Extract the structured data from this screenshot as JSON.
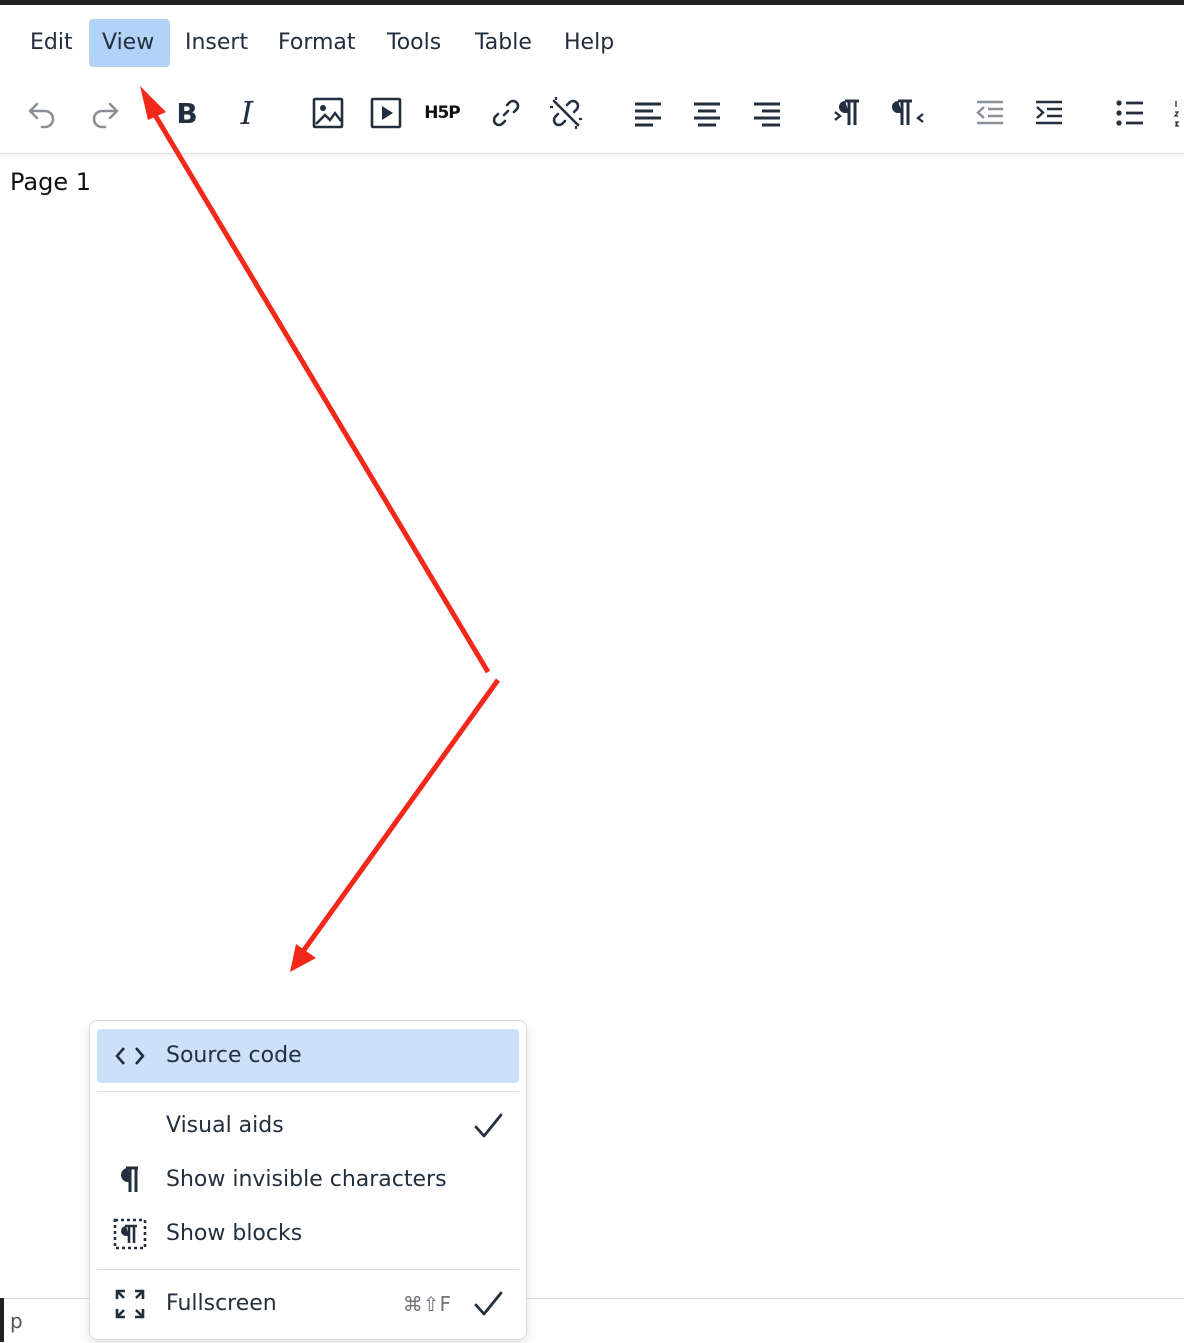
{
  "menubar": {
    "items": [
      "Edit",
      "View",
      "Insert",
      "Format",
      "Tools",
      "Table",
      "Help"
    ],
    "active": "View"
  },
  "toolbar": {
    "buttons": [
      {
        "name": "undo-button",
        "icon": "undo-icon"
      },
      {
        "name": "redo-button",
        "icon": "redo-icon"
      },
      {
        "name": "bold-button",
        "icon": "bold-icon",
        "glyph": "B"
      },
      {
        "name": "italic-button",
        "icon": "italic-icon",
        "glyph": "I"
      },
      {
        "name": "insert-image-button",
        "icon": "image-icon"
      },
      {
        "name": "insert-media-button",
        "icon": "play-icon"
      },
      {
        "name": "h5p-button",
        "icon": "h5p-icon",
        "glyph": "H5P"
      },
      {
        "name": "insert-link-button",
        "icon": "link-icon"
      },
      {
        "name": "remove-link-button",
        "icon": "unlink-icon"
      },
      {
        "name": "align-left-button",
        "icon": "align-left-icon"
      },
      {
        "name": "align-center-button",
        "icon": "align-center-icon"
      },
      {
        "name": "align-right-button",
        "icon": "align-right-icon"
      },
      {
        "name": "ltr-button",
        "icon": "ltr-icon"
      },
      {
        "name": "rtl-button",
        "icon": "rtl-icon"
      },
      {
        "name": "outdent-button",
        "icon": "outdent-icon"
      },
      {
        "name": "indent-button",
        "icon": "indent-icon"
      },
      {
        "name": "bullet-list-button",
        "icon": "bullet-list-icon"
      },
      {
        "name": "numbered-list-button",
        "icon": "numbered-list-icon"
      }
    ]
  },
  "editor": {
    "content": "Page 1"
  },
  "statusbar": {
    "path": "p"
  },
  "view_menu": {
    "items": [
      {
        "label": "Source code",
        "icon": "source-code-icon",
        "highlighted": true
      },
      {
        "label": "Visual aids",
        "checked": true
      },
      {
        "label": "Show invisible characters",
        "icon": "pilcrow-icon"
      },
      {
        "label": "Show blocks",
        "icon": "show-blocks-icon"
      },
      {
        "label": "Fullscreen",
        "icon": "fullscreen-icon",
        "shortcut": "⌘⇧F",
        "checked": true
      }
    ]
  },
  "colors": {
    "active_menu": "#b3d2f7",
    "highlight_item": "#cce0fa",
    "text": "#222f3e",
    "annotation_arrow": "#f2291a"
  }
}
